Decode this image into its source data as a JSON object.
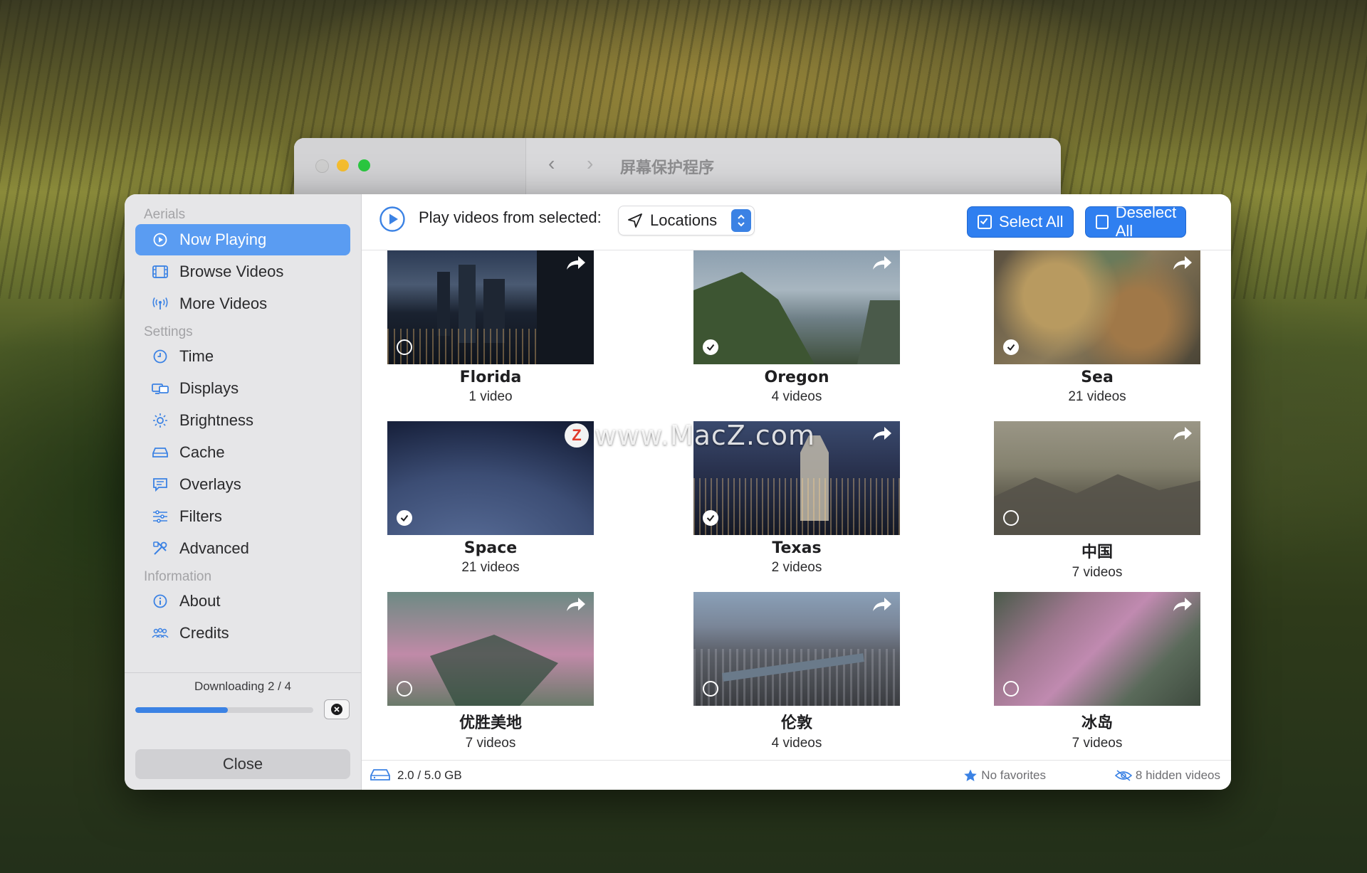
{
  "back_window": {
    "title": "屏幕保护程序",
    "nav_back": "‹",
    "nav_forward": "›"
  },
  "sidebar": {
    "sections": [
      {
        "label": "Aerials"
      },
      {
        "label": "Settings"
      },
      {
        "label": "Information"
      }
    ],
    "items": [
      {
        "label": "Now Playing",
        "icon": "play-circle-icon",
        "active": true
      },
      {
        "label": "Browse Videos",
        "icon": "film-icon"
      },
      {
        "label": "More Videos",
        "icon": "broadcast-icon"
      },
      {
        "label": "Time",
        "icon": "clock-icon"
      },
      {
        "label": "Displays",
        "icon": "displays-icon"
      },
      {
        "label": "Brightness",
        "icon": "sun-icon"
      },
      {
        "label": "Cache",
        "icon": "drive-icon"
      },
      {
        "label": "Overlays",
        "icon": "message-icon"
      },
      {
        "label": "Filters",
        "icon": "sliders-icon"
      },
      {
        "label": "Advanced",
        "icon": "tools-icon"
      },
      {
        "label": "About",
        "icon": "info-icon"
      },
      {
        "label": "Credits",
        "icon": "people-icon"
      }
    ],
    "download": {
      "label": "Downloading 2 / 4",
      "progress": 0.52
    },
    "close_label": "Close"
  },
  "toolbar": {
    "play_label": "Play videos from selected:",
    "locations_label": "Locations",
    "select_all": "Select All",
    "deselect_all": "Deselect All"
  },
  "locations": [
    {
      "title": "Florida",
      "count": "1 video",
      "checked": false
    },
    {
      "title": "Oregon",
      "count": "4 videos",
      "checked": true
    },
    {
      "title": "Sea",
      "count": "21 videos",
      "checked": true
    },
    {
      "title": "Space",
      "count": "21 videos",
      "checked": true
    },
    {
      "title": "Texas",
      "count": "2 videos",
      "checked": true
    },
    {
      "title": "中国",
      "count": "7 videos",
      "checked": false
    },
    {
      "title": "优胜美地",
      "count": "7 videos",
      "checked": false
    },
    {
      "title": "伦敦",
      "count": "4 videos",
      "checked": false
    },
    {
      "title": "冰岛",
      "count": "7 videos",
      "checked": false
    }
  ],
  "footer": {
    "storage": "2.0 / 5.0 GB",
    "favorites": "No favorites",
    "hidden": "8 hidden videos"
  },
  "watermark": {
    "badge": "Z",
    "text": "www.MacZ.com"
  },
  "colors": {
    "accent": "#2f7ff0",
    "active_nav": "#5a9cf2"
  }
}
